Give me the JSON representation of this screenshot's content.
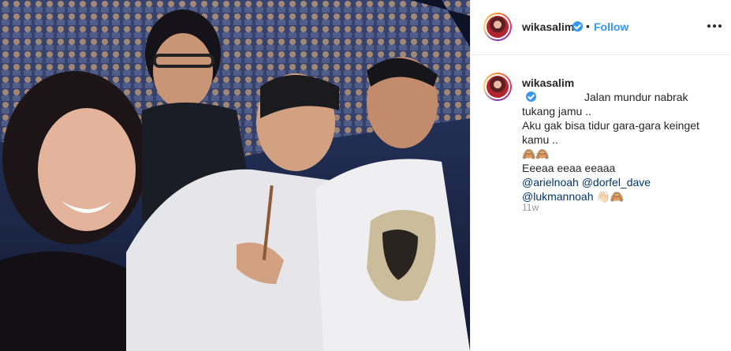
{
  "post": {
    "username": "wikasalim",
    "follow_label": "Follow",
    "separator": "•",
    "caption": {
      "line1": "Jalan mundur nabrak",
      "line2": "tukang jamu ..",
      "line3": "Aku gak bisa tidur gara-gara keinget",
      "line4": "kamu ..",
      "line5": "🙈🙈",
      "line6": "Eeeaa eeaa eeaaa",
      "mention1": "@arielnoah",
      "mention2": "@dorfel_dave",
      "mention3": "@lukmannoah",
      "emoji_end": "👋🏻🙈"
    },
    "timestamp": "11w"
  },
  "icons": {
    "verified": "verified-badge-icon",
    "more": "more-options-icon"
  },
  "colors": {
    "link_blue": "#3897f0",
    "mention_blue": "#003569",
    "text": "#262626",
    "muted": "#999999"
  }
}
